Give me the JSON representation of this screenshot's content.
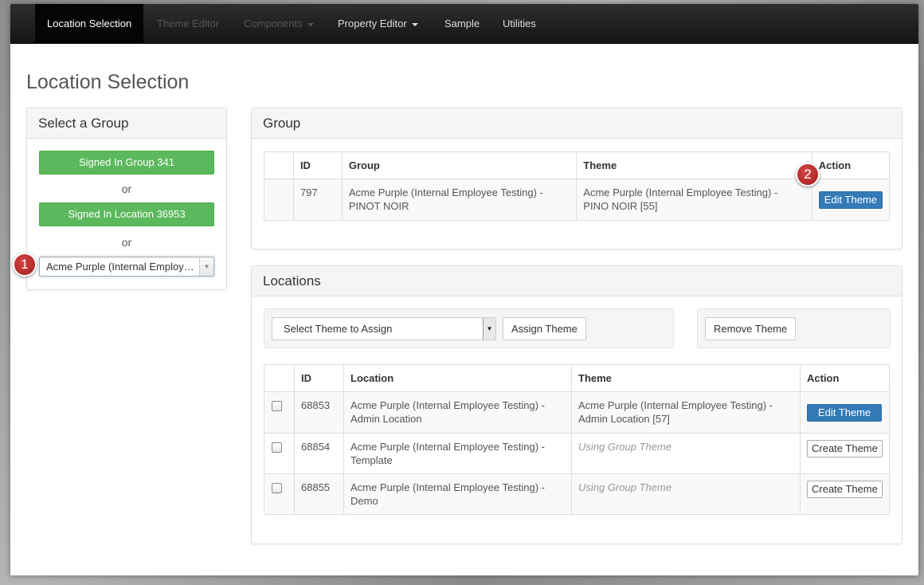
{
  "nav": {
    "items": [
      {
        "label": "Location Selection",
        "state": "active",
        "dropdown": false
      },
      {
        "label": "Theme Editor",
        "state": "disabled",
        "dropdown": false
      },
      {
        "label": "Components",
        "state": "disabled",
        "dropdown": true
      },
      {
        "label": "Property Editor",
        "state": "normal",
        "dropdown": true
      },
      {
        "label": "Sample",
        "state": "normal",
        "dropdown": false
      },
      {
        "label": "Utilities",
        "state": "normal",
        "dropdown": false
      }
    ]
  },
  "page_title": "Location Selection",
  "select_group": {
    "heading": "Select a Group",
    "signed_in_group_label": "Signed In Group 341",
    "or_1": "or",
    "signed_in_location_label": "Signed In Location 36953",
    "or_2": "or",
    "group_select_value": "Acme Purple (Internal Employee Testing) - PINOT NOIR"
  },
  "badges": {
    "one": "1",
    "two": "2"
  },
  "group_panel": {
    "heading": "Group",
    "columns": {
      "id": "ID",
      "group": "Group",
      "theme": "Theme",
      "action": "Action"
    },
    "row": {
      "id": "797",
      "group_line1": "Acme Purple (Internal Employee Testing) -",
      "group_line2": "PINOT NOIR",
      "theme_line1": "Acme Purple (Internal Employee Testing) -",
      "theme_line2": "PINO NOIR [55]",
      "action_label": "Edit Theme"
    }
  },
  "locations_panel": {
    "heading": "Locations",
    "theme_select_placeholder": "Select Theme to Assign",
    "assign_label": "Assign Theme",
    "remove_label": "Remove Theme",
    "columns": {
      "id": "ID",
      "location": "Location",
      "theme": "Theme",
      "action": "Action"
    },
    "rows": [
      {
        "id": "68853",
        "location_line1": "Acme Purple (Internal Employee Testing) -",
        "location_line2": "Admin Location",
        "theme_line1": "Acme Purple (Internal Employee Testing) -",
        "theme_line2": "Admin Location [57]",
        "action_label": "Edit Theme",
        "checked": false
      },
      {
        "id": "68854",
        "location_line1": "Acme Purple (Internal Employee Testing) -",
        "location_line2": "Template",
        "theme_line1": "Using Group Theme",
        "theme_line2": "",
        "action_label": "Create Theme",
        "checked": false
      },
      {
        "id": "68855",
        "location_line1": "Acme Purple (Internal Employee Testing) -",
        "location_line2": "Demo",
        "theme_line1": "Using Group Theme",
        "theme_line2": "",
        "action_label": "Create Theme",
        "checked": false
      }
    ]
  },
  "colors": {
    "navbar": "#1a1a1a",
    "success": "#5cb85c",
    "primary": "#337ab7",
    "badge": "#b82828"
  }
}
